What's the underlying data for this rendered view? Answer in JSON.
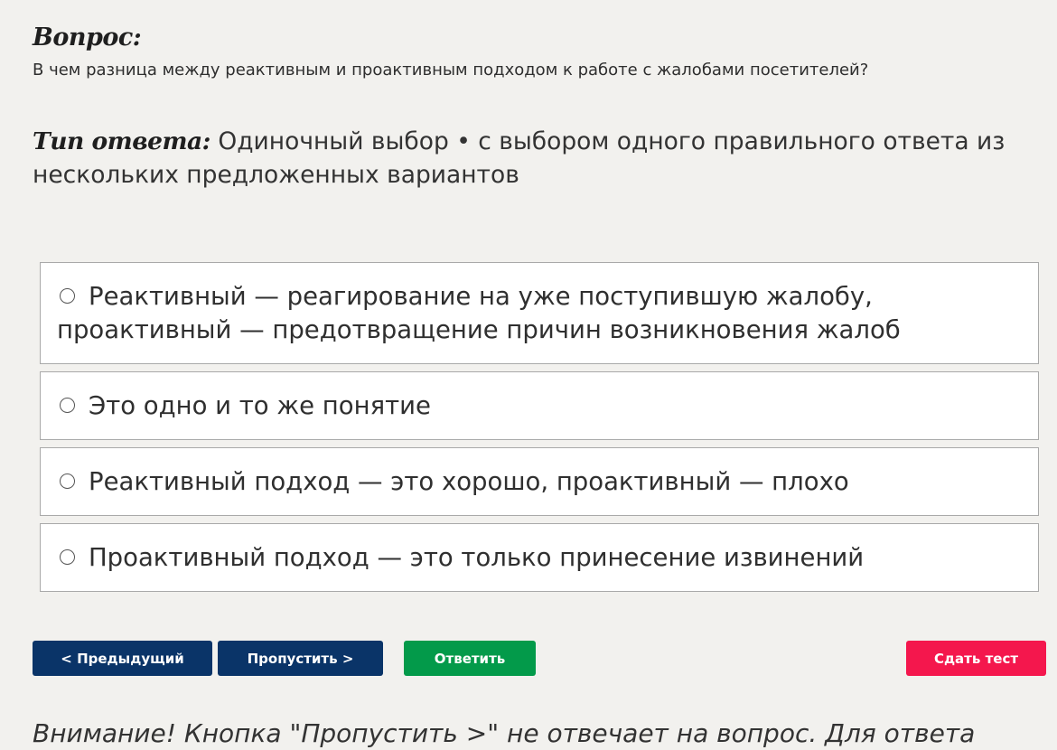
{
  "question": {
    "heading": "Вопрос:",
    "text": "В чем разница между реактивным и проактивным подходом к работе с жалобами посетителей?"
  },
  "answer_type": {
    "label": "Тип ответа:",
    "value": " Одиночный выбор • с выбором одного правильного ответа из нескольких предложенных вариантов"
  },
  "options": [
    {
      "text": "Реактивный — реагирование на уже поступившую жалобу, проактивный — предотвращение причин возникновения жалоб",
      "selected": false
    },
    {
      "text": "Это одно и то же понятие",
      "selected": false
    },
    {
      "text": "Реактивный подход — это хорошо, проактивный — плохо",
      "selected": false
    },
    {
      "text": "Проактивный подход — это только принесение извинений",
      "selected": false
    }
  ],
  "buttons": {
    "prev": "< Предыдущий",
    "skip": "Пропустить >",
    "answer": "Ответить",
    "submit": "Сдать тест"
  },
  "colors": {
    "nav_button": "#0a3468",
    "answer_button": "#039a4a",
    "submit_button": "#f4174d",
    "background": "#f2f1ee"
  },
  "warning": "Внимание! Кнопка \"Пропустить >\" не отвечает на вопрос. Для ответа"
}
